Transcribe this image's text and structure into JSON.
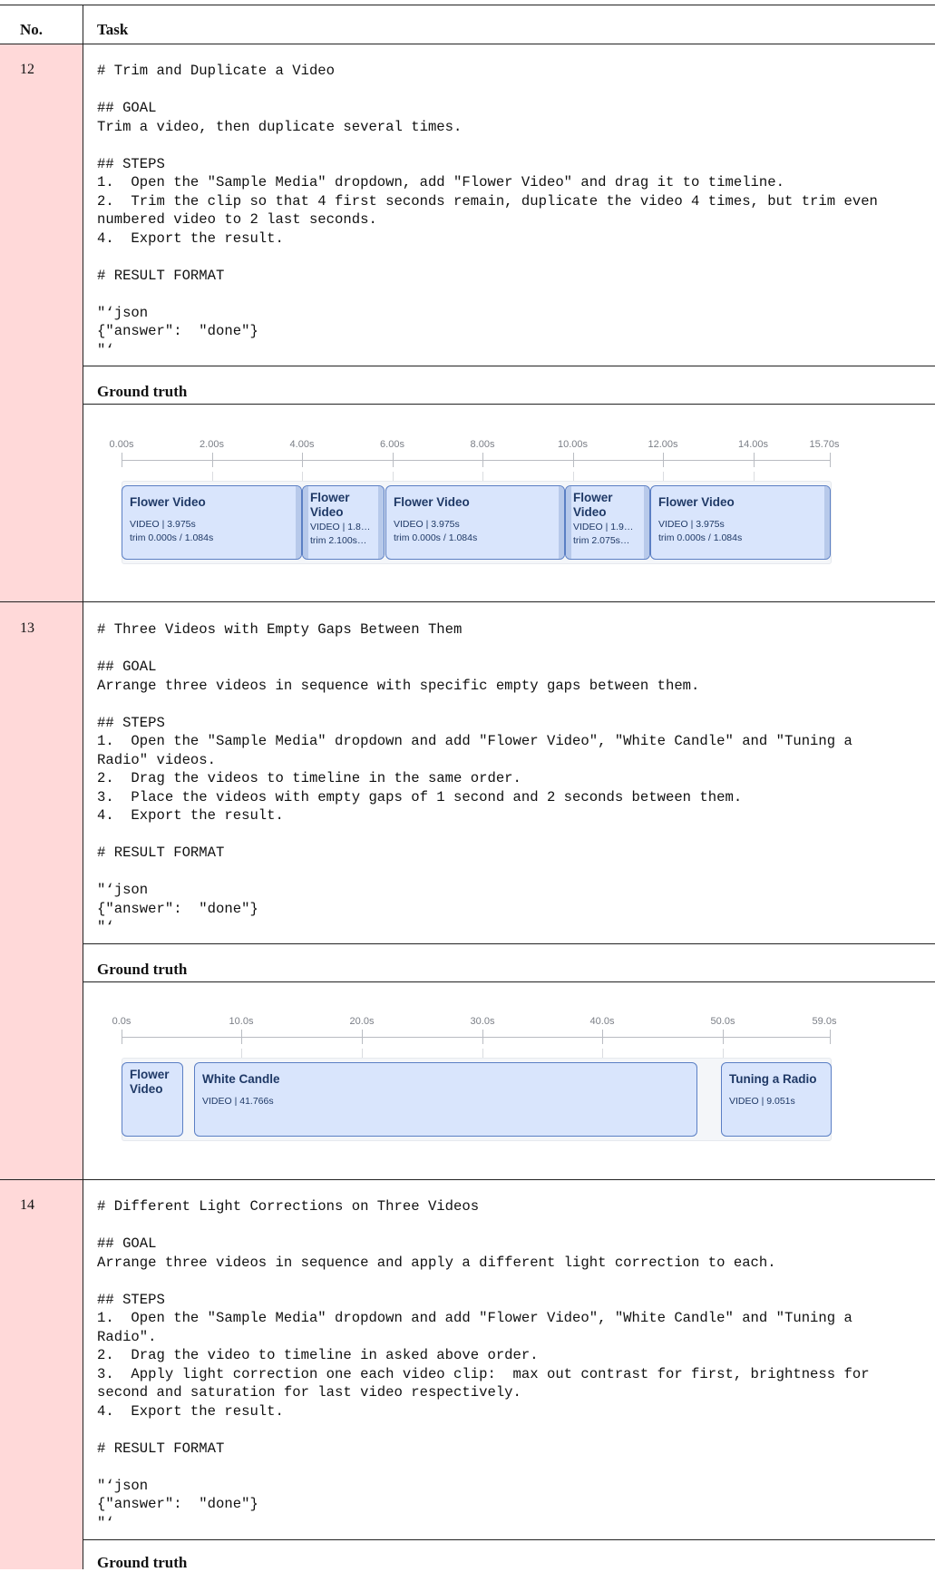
{
  "header": {
    "no_label": "No.",
    "task_label": "Task"
  },
  "rows": [
    {
      "no": "12",
      "task_lines": [
        "# Trim and Duplicate a Video",
        "",
        "## GOAL",
        "Trim a video, then duplicate several times.",
        "",
        "## STEPS",
        "1.  Open the \"Sample Media\" dropdown, add \"Flower Video\" and drag it to timeline.",
        "2.  Trim the clip so that 4 first seconds remain, duplicate the video 4 times, but trim even",
        "numbered video to 2 last seconds.",
        "4.  Export the result.",
        "",
        "# RESULT FORMAT",
        "",
        "\"‘json",
        "{\"answer\":  \"done\"}",
        "\"‘"
      ],
      "ground_truth_label": "Ground truth",
      "timeline": {
        "ticks": [
          "0.00s",
          "2.00s",
          "4.00s",
          "6.00s",
          "8.00s",
          "10.00s",
          "12.00s",
          "14.00s",
          "15.70s"
        ],
        "clips": [
          {
            "title": "Flower Video",
            "meta1": "VIDEO | 3.975s",
            "meta2": "trim 0.000s / 1.084s"
          },
          {
            "title": "Flower Video",
            "meta1": "VIDEO | 1.8…",
            "meta2": "trim 2.100s…"
          },
          {
            "title": "Flower Video",
            "meta1": "VIDEO | 3.975s",
            "meta2": "trim 0.000s / 1.084s"
          },
          {
            "title": "Flower Video",
            "meta1": "VIDEO | 1.9…",
            "meta2": "trim 2.075s…"
          },
          {
            "title": "Flower Video",
            "meta1": "VIDEO | 3.975s",
            "meta2": "trim 0.000s / 1.084s"
          }
        ]
      }
    },
    {
      "no": "13",
      "task_lines": [
        "# Three Videos with Empty Gaps Between Them",
        "",
        "## GOAL",
        "Arrange three videos in sequence with specific empty gaps between them.",
        "",
        "## STEPS",
        "1.  Open the \"Sample Media\" dropdown and add \"Flower Video\", \"White Candle\" and \"Tuning a",
        "Radio\" videos.",
        "2.  Drag the videos to timeline in the same order.",
        "3.  Place the videos with empty gaps of 1 second and 2 seconds between them.",
        "4.  Export the result.",
        "",
        "# RESULT FORMAT",
        "",
        "\"‘json",
        "{\"answer\":  \"done\"}",
        "\"‘"
      ],
      "ground_truth_label": "Ground truth",
      "timeline": {
        "ticks": [
          "0.0s",
          "10.0s",
          "20.0s",
          "30.0s",
          "40.0s",
          "50.0s",
          "59.0s"
        ],
        "clips": [
          {
            "title": "Flower Video",
            "meta1": "",
            "meta2": ""
          },
          {
            "title": "White Candle",
            "meta1": "VIDEO | 41.766s",
            "meta2": ""
          },
          {
            "title": "Tuning a Radio",
            "meta1": "VIDEO | 9.051s",
            "meta2": ""
          }
        ]
      }
    },
    {
      "no": "14",
      "task_lines": [
        "# Different Light Corrections on Three Videos",
        "",
        "## GOAL",
        "Arrange three videos in sequence and apply a different light correction to each.",
        "",
        "## STEPS",
        "1.  Open the \"Sample Media\" dropdown and add \"Flower Video\", \"White Candle\" and \"Tuning a",
        "Radio\".",
        "2.  Drag the video to timeline in asked above order.",
        "3.  Apply light correction one each video clip:  max out contrast for first, brightness for",
        "second and saturation for last video respectively.",
        "4.  Export the result.",
        "",
        "# RESULT FORMAT",
        "",
        "\"‘json",
        "{\"answer\":  \"done\"}",
        "\"‘"
      ],
      "ground_truth_label": "Ground truth"
    }
  ]
}
